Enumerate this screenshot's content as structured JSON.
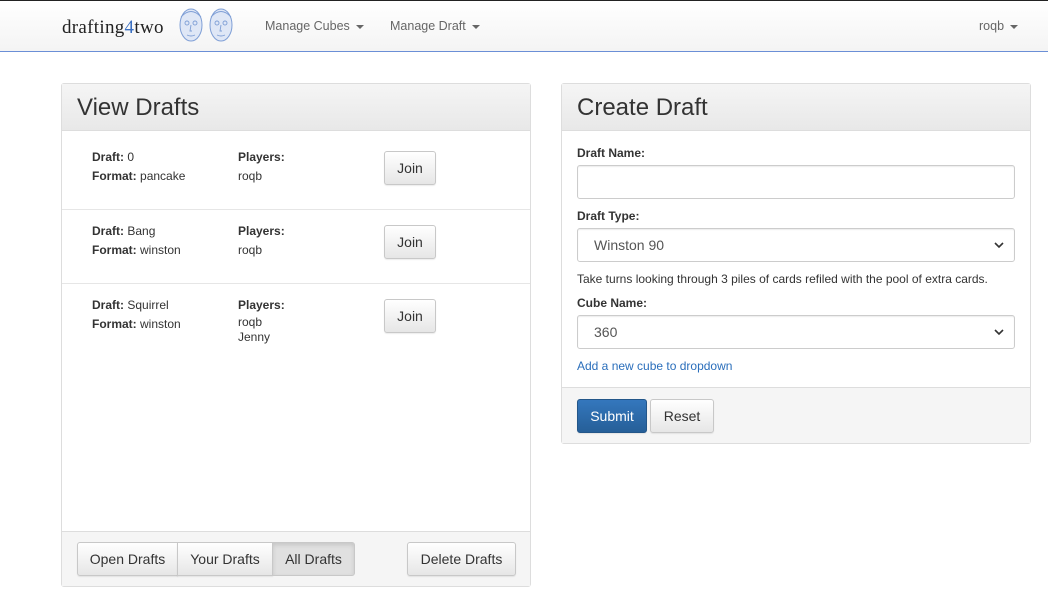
{
  "brand": {
    "prefix": "drafting",
    "number": "4",
    "suffix": "two"
  },
  "nav": {
    "manage_cubes": "Manage Cubes",
    "manage_draft": "Manage Draft",
    "user": "roqb"
  },
  "view_drafts": {
    "title": "View Drafts",
    "draft_label": "Draft:",
    "format_label": "Format:",
    "players_label": "Players:",
    "join_label": "Join",
    "drafts": [
      {
        "name": "0",
        "format": "pancake",
        "players": [
          "roqb"
        ]
      },
      {
        "name": "Bang",
        "format": "winston",
        "players": [
          "roqb"
        ]
      },
      {
        "name": "Squirrel",
        "format": "winston",
        "players": [
          "roqb",
          "Jenny"
        ]
      }
    ],
    "filters": [
      "Open Drafts",
      "Your Drafts",
      "All Drafts"
    ],
    "active_filter": "All Drafts",
    "delete_label": "Delete Drafts"
  },
  "create_draft": {
    "title": "Create Draft",
    "name_label": "Draft Name:",
    "name_value": "",
    "type_label": "Draft Type:",
    "type_value": "Winston 90",
    "type_help": "Take turns looking through 3 piles of cards refiled with the pool of extra cards.",
    "cube_label": "Cube Name:",
    "cube_value": "360",
    "add_cube_link": "Add a new cube to dropdown",
    "submit_label": "Submit",
    "reset_label": "Reset"
  }
}
